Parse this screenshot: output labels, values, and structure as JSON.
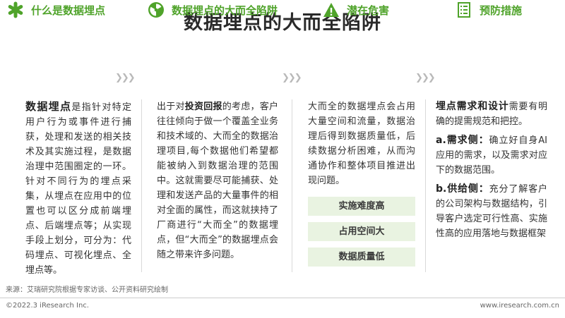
{
  "title": "数据埋点的大而全陷阱",
  "headers": [
    {
      "label": "什么是数据埋点",
      "icon": "asterisk-icon"
    },
    {
      "label": "数据埋点的大而全陷阱",
      "icon": "hazard-icon"
    },
    {
      "label": "潜在危害",
      "icon": "warning-icon"
    },
    {
      "label": "预防措施",
      "icon": "checklist-icon"
    }
  ],
  "chevrons": "❯❯❯",
  "col1": {
    "term": "数据埋点",
    "text": "是指针对特定用户行为或事件进行捕获，处理和发送的相关技术及其实施过程，是数据治理中范围圈定的一环。针对不同行为的埋点采集，从埋点在应用中的位置也可以区分成前端埋点、后端埋点等；从实现手段上划分，可分为：代码埋点、可视化埋点、全埋点等。"
  },
  "col2": {
    "prefix": "出于对",
    "term": "投资回报",
    "text": "的考虑，客户往往倾向于做一个覆盖全业务和技术域的、大而全的数据治理项目,每个数据他们希望都能被纳入到数据治理的范围中。这就需要尽可能捕获、处理和发送产品的大量事件的相对全面的属性，而这就挟持了厂商进行“大而全”的数据埋点，但“大而全”的数据埋点会随之带来许多问题。"
  },
  "col3": {
    "text": "大而全的数据埋点会占用大量空间和流量，数据治理后得到数据质量低，后续数据分析困难，从而沟通协作和整体项目推进出现问题。",
    "tags": [
      "实施难度高",
      "占用空间大",
      "数据质量低"
    ]
  },
  "col4": {
    "intro_term": "埋点需求和设计",
    "intro_text": "需要有明确的提需规范和把控。",
    "a_term": "a.需求侧：",
    "a_text": "确立好自身AI应用的需求，以及需求对应下的数据范围。",
    "b_term": "b.供给侧：",
    "b_text": "充分了解客户的公司架构与数据结构，引导客户选定可行性高、实施性高的应用落地与数据框架"
  },
  "source": "来源：艾瑞研究院根据专家访谈、公开资料研究绘制",
  "footer_left": "©2022.3 iResearch Inc.",
  "footer_right": "www.iresearch.com.cn",
  "colors": {
    "accent_green": "#4fa32a",
    "tag_bg": "#e9f3e1"
  }
}
